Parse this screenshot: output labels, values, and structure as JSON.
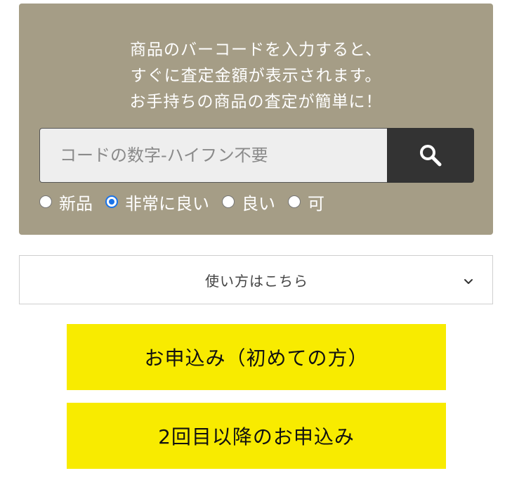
{
  "intro": {
    "line1": "商品のバーコードを入力すると、",
    "line2": "すぐに査定金額が表示されます。",
    "line3": "お手持ちの商品の査定が簡単に！"
  },
  "search": {
    "placeholder": "コードの数字-ハイフン不要",
    "value": "",
    "button_icon": "search-icon"
  },
  "condition": {
    "options": [
      "新品",
      "非常に良い",
      "良い",
      "可"
    ],
    "selected": "非常に良い"
  },
  "howto": {
    "label": "使い方はこちら",
    "icon": "chevron-down-icon"
  },
  "buttons": {
    "first_apply": "お申込み（初めての方）",
    "repeat_apply": "2回目以降のお申込み"
  },
  "colors": {
    "panel_bg": "#a59d86",
    "search_button_bg": "#333333",
    "cta_bg": "#f8eb00",
    "radio_selected": "#1a73e8"
  }
}
